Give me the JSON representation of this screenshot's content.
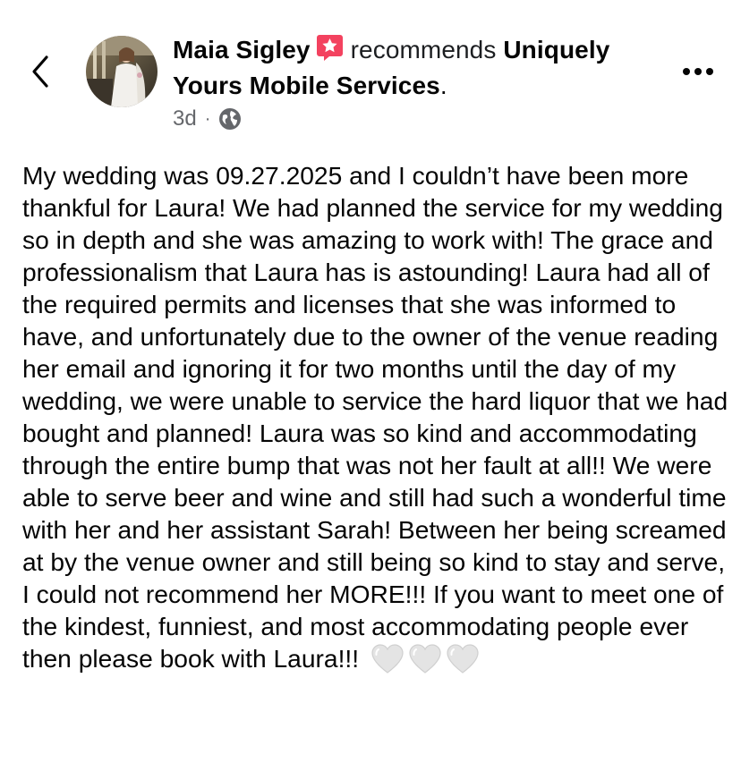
{
  "header": {
    "author_name": "Maia Sigley",
    "verb": "recommends",
    "page_name": "Uniquely Yours Mobile Services",
    "trailing_period": ".",
    "timestamp": "3d",
    "separator": "·",
    "audience_icon": "globe-icon",
    "badge_icon": "recommendation-star-badge-icon",
    "badge_color": "#f3425f"
  },
  "post": {
    "text": "My wedding was 09.27.2025 and I couldn’t have been more thankful for Laura! We had planned the service for my wedding so in depth and she was amazing to work with! The grace and professionalism that Laura has is astounding! Laura had all of the required permits and licenses that she was informed to have, and unfortunately due to the owner of the venue reading her email and ignoring it for two months until the day of my wedding, we were unable to service the hard liquor that we had bought and planned! Laura was so kind and accommodating through the entire bump that was not her fault at all!! We were able to serve beer and wine and still had such a wonderful time with her and her assistant Sarah! Between her being screamed at by the venue owner and still being so kind to stay and serve, I could not recommend her MORE!!! If you want to meet one of the kindest, funniest, and most accommodating people ever then please book with Laura!!!",
    "emoji_icons": [
      "white-heart-icon",
      "white-heart-icon",
      "white-heart-icon"
    ]
  },
  "icons": {
    "back": "chevron-left-icon",
    "more": "more-options-icon"
  },
  "colors": {
    "text": "#050505",
    "secondary_text": "#65676b",
    "badge": "#f3425f"
  }
}
